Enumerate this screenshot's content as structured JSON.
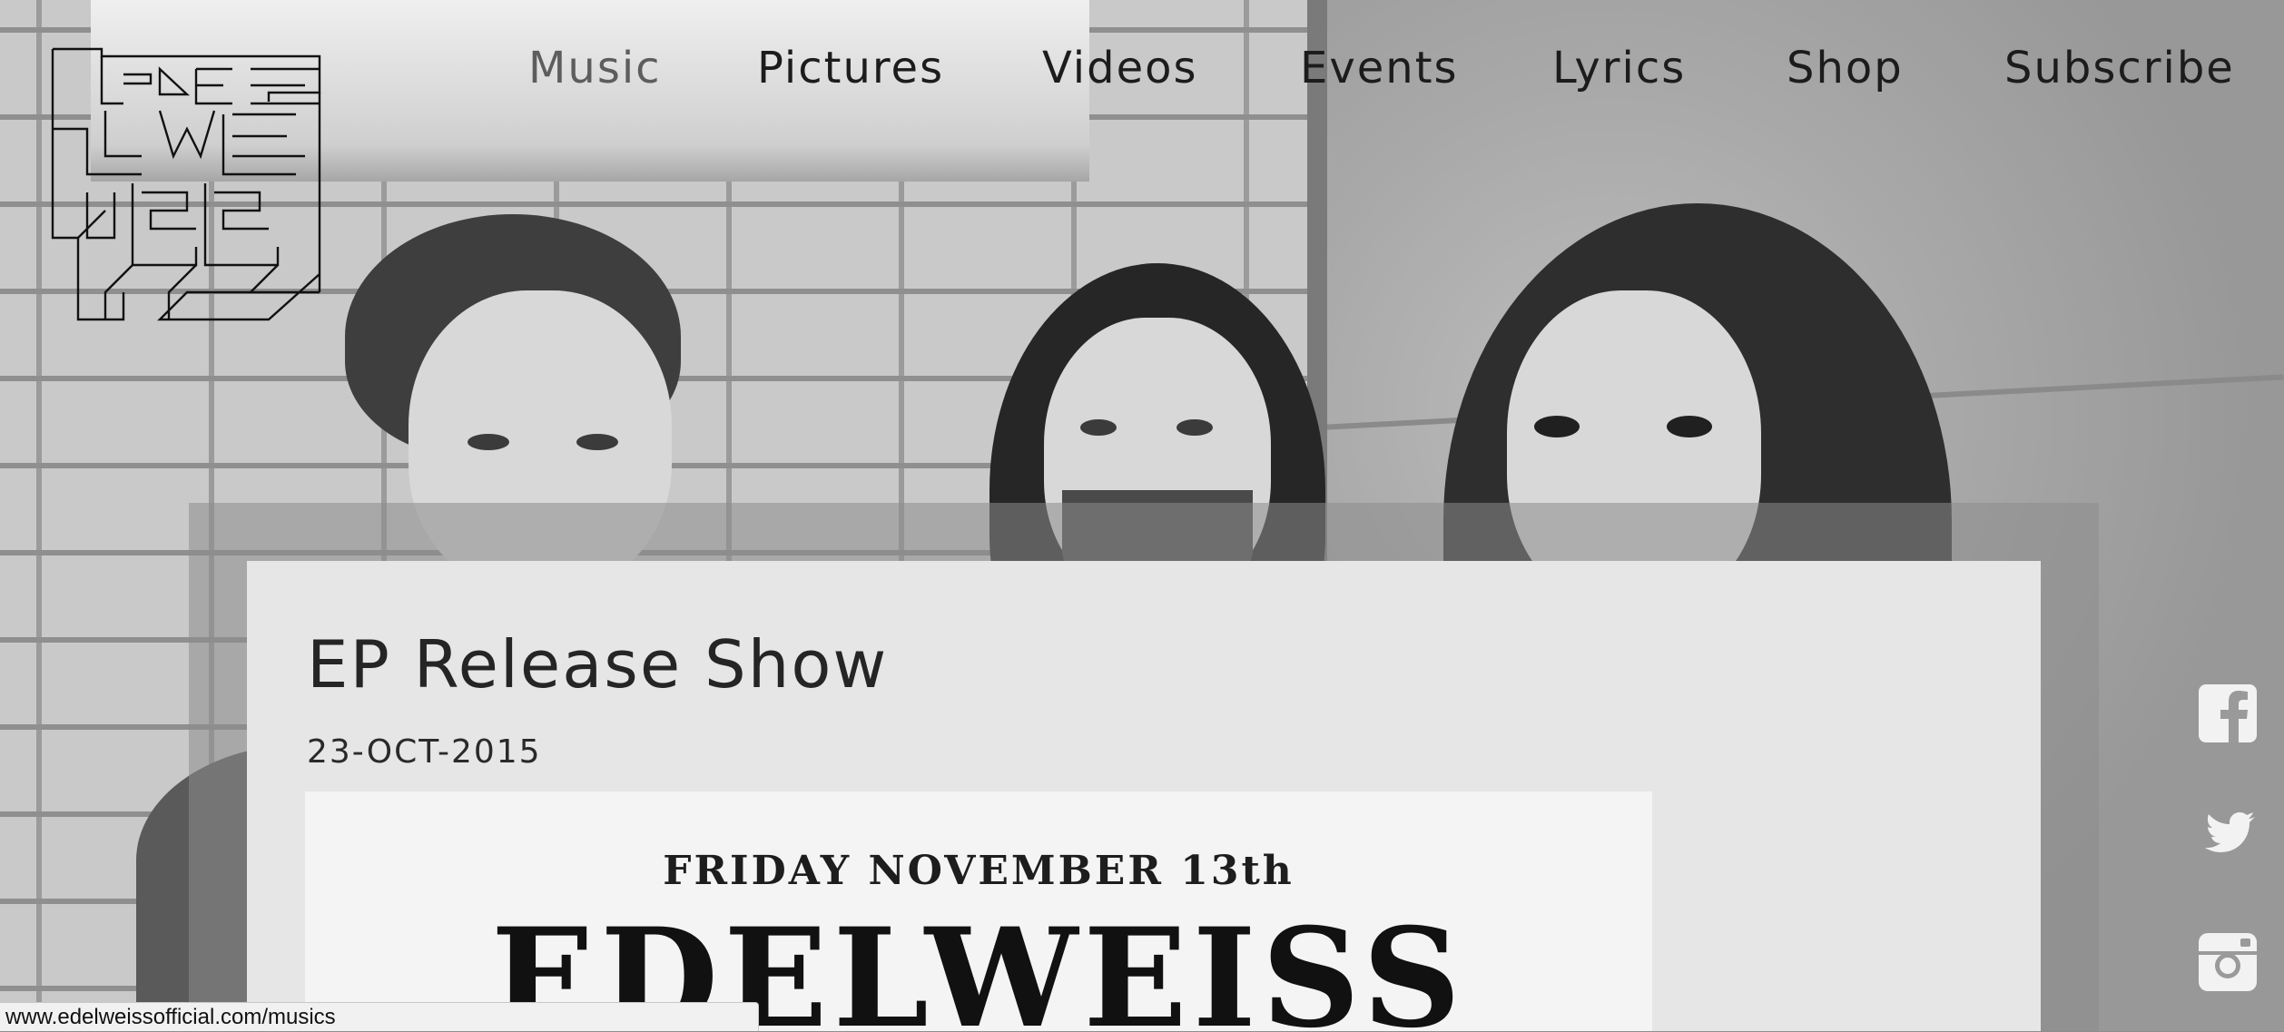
{
  "site": {
    "logo_text": "EDELWEISS"
  },
  "nav": {
    "items": [
      {
        "label": "Music",
        "active": true
      },
      {
        "label": "Pictures",
        "active": false
      },
      {
        "label": "Videos",
        "active": false
      },
      {
        "label": "Events",
        "active": false
      },
      {
        "label": "Lyrics",
        "active": false
      },
      {
        "label": "Shop",
        "active": false
      },
      {
        "label": "Subscribe",
        "active": false
      }
    ]
  },
  "post": {
    "title": "EP Release Show",
    "date": "23-OCT-2015",
    "poster": {
      "date_line": "FRIDAY NOVEMBER 13th",
      "band_name": "EDELWEISS"
    }
  },
  "social": {
    "icons": [
      "facebook-icon",
      "twitter-icon",
      "instagram-icon"
    ]
  },
  "status_bar": {
    "url": "www.edelweissofficial.com/musics"
  }
}
